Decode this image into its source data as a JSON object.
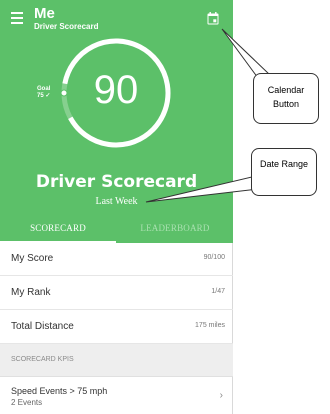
{
  "header": {
    "title": "Me",
    "subtitle": "Driver Scorecard",
    "menu_icon": "hamburger-menu-icon",
    "calendar_icon": "calendar-icon",
    "background_color": "#5cc069"
  },
  "gauge": {
    "score": "90",
    "goal_label": "Goal",
    "goal_value": "75 ✓",
    "score_fraction": 0.9,
    "goal_fraction": 0.75
  },
  "hero": {
    "title": "Driver Scorecard",
    "date_range": "Last Week"
  },
  "tabs": [
    {
      "label": "SCORECARD",
      "active": true
    },
    {
      "label": "LEADERBOARD",
      "active": false
    }
  ],
  "stats": [
    {
      "label": "My Score",
      "value": "90/100"
    },
    {
      "label": "My Rank",
      "value": "1/47"
    },
    {
      "label": "Total Distance",
      "value": "175 miles"
    }
  ],
  "kpi_section": {
    "header": "SCORECARD KPIS",
    "items": [
      {
        "name": "Speed Events > 75 mph",
        "count": "2 Events",
        "chevron": "›"
      }
    ]
  },
  "annotations": {
    "calendar_button": "Calendar Button",
    "date_range": "Date Range"
  }
}
